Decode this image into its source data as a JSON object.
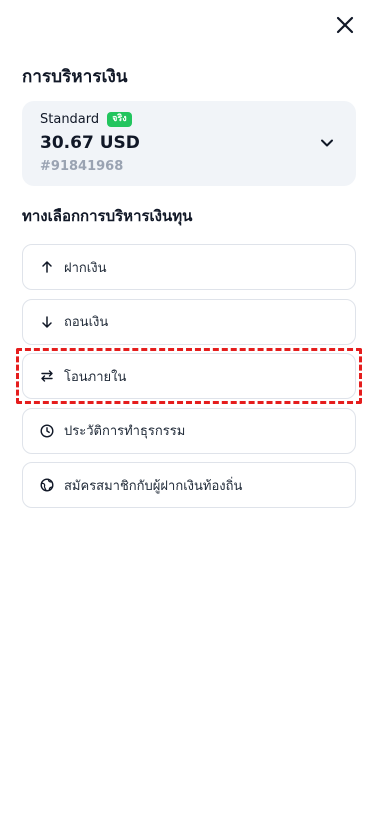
{
  "header": {
    "title": "การบริหารเงิน",
    "close_icon": "close-icon"
  },
  "account": {
    "type": "Standard",
    "badge": "จริง",
    "badge_color": "#22c55e",
    "balance": "30.67 USD",
    "number": "#91841968"
  },
  "options_section": {
    "title": "ทางเลือกการบริหารเงินทุน",
    "items": [
      {
        "label": "ฝากเงิน",
        "icon": "arrow-up-icon"
      },
      {
        "label": "ถอนเงิน",
        "icon": "arrow-down-icon"
      },
      {
        "label": "โอนภายใน",
        "icon": "transfer-arrows-icon",
        "highlighted": true
      },
      {
        "label": "ประวัติการทำธุรกรรม",
        "icon": "clock-icon"
      },
      {
        "label": "สมัครสมาชิกกับผู้ฝากเงินท้องถิ่น",
        "icon": "globe-icon"
      }
    ]
  },
  "colors": {
    "card_bg": "#f1f4f8",
    "highlight": "#e51d1d"
  }
}
